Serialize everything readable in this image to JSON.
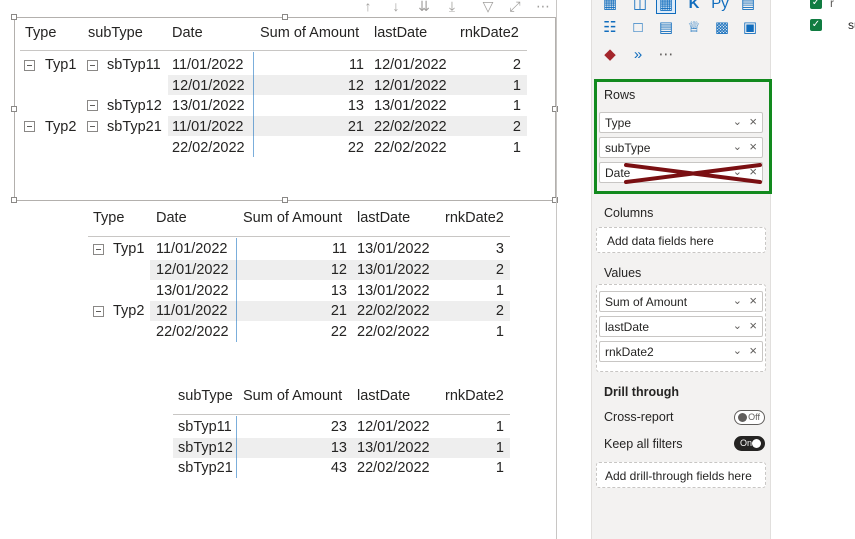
{
  "visual1": {
    "headers": {
      "type": "Type",
      "subtype": "subType",
      "date": "Date",
      "sum": "Sum of Amount",
      "lastdate": "lastDate",
      "rnk": "rnkDate2"
    },
    "rows": [
      {
        "type": "Typ1",
        "subtype": "sbTyp11",
        "date": "11/01/2022",
        "sum": "11",
        "lastdate": "12/01/2022",
        "rnk": "2"
      },
      {
        "type": "",
        "subtype": "",
        "date": "12/01/2022",
        "sum": "12",
        "lastdate": "12/01/2022",
        "rnk": "1"
      },
      {
        "type": "",
        "subtype": "sbTyp12",
        "date": "13/01/2022",
        "sum": "13",
        "lastdate": "13/01/2022",
        "rnk": "1"
      },
      {
        "type": "Typ2",
        "subtype": "sbTyp21",
        "date": "11/01/2022",
        "sum": "21",
        "lastdate": "22/02/2022",
        "rnk": "2"
      },
      {
        "type": "",
        "subtype": "",
        "date": "22/02/2022",
        "sum": "22",
        "lastdate": "22/02/2022",
        "rnk": "1"
      }
    ]
  },
  "visual2": {
    "headers": {
      "type": "Type",
      "date": "Date",
      "sum": "Sum of Amount",
      "lastdate": "lastDate",
      "rnk": "rnkDate2"
    },
    "rows": [
      {
        "type": "Typ1",
        "date": "11/01/2022",
        "sum": "11",
        "lastdate": "13/01/2022",
        "rnk": "3"
      },
      {
        "type": "",
        "date": "12/01/2022",
        "sum": "12",
        "lastdate": "13/01/2022",
        "rnk": "2"
      },
      {
        "type": "",
        "date": "13/01/2022",
        "sum": "13",
        "lastdate": "13/01/2022",
        "rnk": "1"
      },
      {
        "type": "Typ2",
        "date": "11/01/2022",
        "sum": "21",
        "lastdate": "22/02/2022",
        "rnk": "2"
      },
      {
        "type": "",
        "date": "22/02/2022",
        "sum": "22",
        "lastdate": "22/02/2022",
        "rnk": "1"
      }
    ]
  },
  "visual3": {
    "headers": {
      "subtype": "subType",
      "sum": "Sum of Amount",
      "lastdate": "lastDate",
      "rnk": "rnkDate2"
    },
    "rows": [
      {
        "subtype": "sbTyp11",
        "sum": "23",
        "lastdate": "12/01/2022",
        "rnk": "1"
      },
      {
        "subtype": "sbTyp12",
        "sum": "13",
        "lastdate": "13/01/2022",
        "rnk": "1"
      },
      {
        "subtype": "sbTyp21",
        "sum": "43",
        "lastdate": "22/02/2022",
        "rnk": "1"
      }
    ]
  },
  "pane": {
    "rows_label": "Rows",
    "rows_fields": [
      "Type",
      "subType",
      "Date"
    ],
    "columns_label": "Columns",
    "columns_placeholder": "Add data fields here",
    "values_label": "Values",
    "values_fields": [
      "Sum of Amount",
      "lastDate",
      "rnkDate2"
    ],
    "drill_label": "Drill through",
    "cross_report_label": "Cross-report",
    "cross_report_state": "Off",
    "keep_filters_label": "Keep all filters",
    "keep_filters_state": "On",
    "drill_placeholder": "Add drill-through fields here"
  },
  "data_pane": {
    "item1": "r",
    "item2": "su"
  },
  "icons": [
    "arrow-up-icon",
    "arrow-down-icon",
    "double-arrow-down-icon",
    "expand-down-icon",
    "filter-icon",
    "focus-mode-icon",
    "more-options-icon"
  ],
  "colors": {
    "highlight_box": "#128a1e",
    "strike": "#7a0f12",
    "band": "#eeeeee",
    "accent": "#0f6cbd"
  }
}
